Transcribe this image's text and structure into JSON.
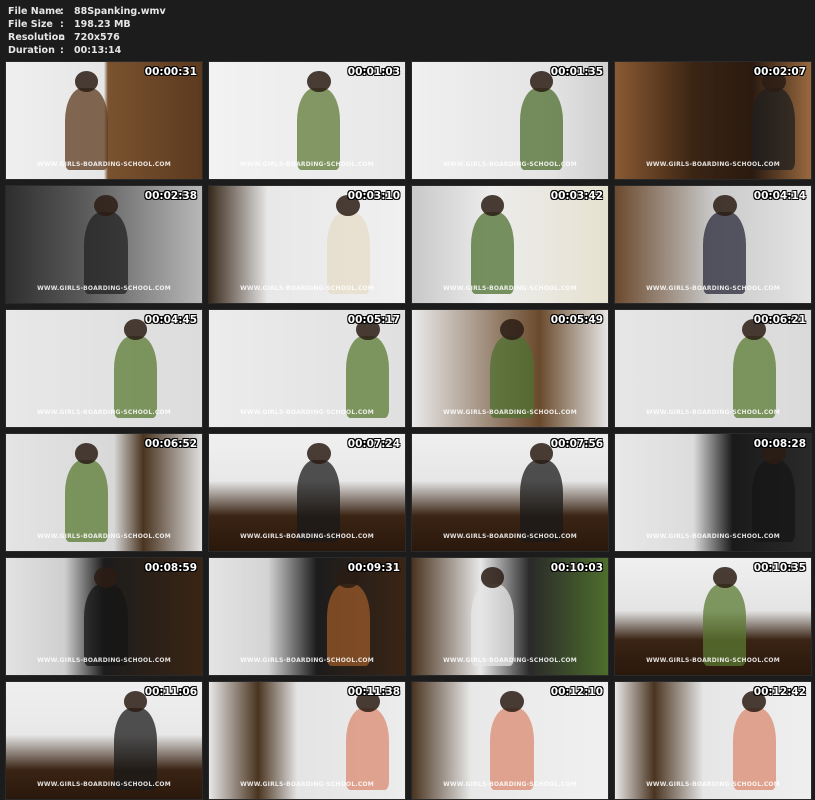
{
  "header": {
    "rows": [
      {
        "label": "File Name",
        "sep": ":",
        "value": "88Spanking.wmv"
      },
      {
        "label": "File Size",
        "sep": ":",
        "value": "198.23 MB"
      },
      {
        "label": "Resolution",
        "sep": ":",
        "value": "720x576"
      },
      {
        "label": "Duration",
        "sep": ":",
        "value": "00:13:14"
      }
    ]
  },
  "watermark": "WWW.GIRLS-BOARDING-SCHOOL.COM",
  "thumbnails": [
    {
      "timestamp": "00:00:31",
      "bg": "linear-gradient(90deg,#efefef 0%,#e6e6e6 50%,#7a5230 52%,#5c3a1e 100%)",
      "fg": "#5c3a1e"
    },
    {
      "timestamp": "00:01:03",
      "bg": "linear-gradient(90deg,#f2f2f2 0%,#e8e8e8 100%)",
      "fg": "#5f7a36"
    },
    {
      "timestamp": "00:01:35",
      "bg": "linear-gradient(90deg,#f0f0f0 0%,#e4e4e4 70%,#cfcfcf 100%)",
      "fg": "#4d6e2c"
    },
    {
      "timestamp": "00:02:07",
      "bg": "linear-gradient(90deg,#8a5a32 0%,#3b2414 40%,#2a1a10 70%,#9a6a40 100%)",
      "fg": "#1f1f1f"
    },
    {
      "timestamp": "00:02:38",
      "bg": "linear-gradient(90deg,#2e2e2e 0%,#5a5a5a 40%,#b8b8b8 100%)",
      "fg": "#222"
    },
    {
      "timestamp": "00:03:10",
      "bg": "linear-gradient(90deg,#3a2a1c 0%,#e8e8e8 30%,#f0f0f0 100%)",
      "fg": "#e5dcc8"
    },
    {
      "timestamp": "00:03:42",
      "bg": "linear-gradient(90deg,#c8c8c8 0%,#ececec 40%,#e6e2d0 100%)",
      "fg": "#4e7030"
    },
    {
      "timestamp": "00:04:14",
      "bg": "linear-gradient(90deg,#6b4a2e 0%,#c9c9c9 50%,#e4e4e4 100%)",
      "fg": "#2a2a3a"
    },
    {
      "timestamp": "00:04:45",
      "bg": "linear-gradient(90deg,#e8e8e8 0%,#dcdcdc 100%)",
      "fg": "#5a7a32"
    },
    {
      "timestamp": "00:05:17",
      "bg": "linear-gradient(90deg,#ececec 0%,#e0e0e0 100%)",
      "fg": "#5a7a32"
    },
    {
      "timestamp": "00:05:49",
      "bg": "linear-gradient(90deg,#eaeaea 0%,#6a4a2c 65%,#e6e6e6 100%)",
      "fg": "#4f7030"
    },
    {
      "timestamp": "00:06:21",
      "bg": "linear-gradient(90deg,#e6e6e6 0%,#dadada 100%)",
      "fg": "#5a7a32"
    },
    {
      "timestamp": "00:06:52",
      "bg": "linear-gradient(90deg,#e4e4e4 0%,#d8d8d8 55%,#4a3420 70%,#e0e0e0 100%)",
      "fg": "#5a7a32"
    },
    {
      "timestamp": "00:07:24",
      "bg": "linear-gradient(180deg,#f0f0f0 0%,#e8e8e8 40%,#3a2414 70%,#2a180c 100%)",
      "fg": "#1a1a1a"
    },
    {
      "timestamp": "00:07:56",
      "bg": "linear-gradient(180deg,#efefef 0%,#e6e6e6 40%,#3a2414 70%,#2a180c 100%)",
      "fg": "#1a1a1a"
    },
    {
      "timestamp": "00:08:28",
      "bg": "linear-gradient(90deg,#e8e8e8 0%,#dcdcdc 40%,#1a1a1a 60%,#2a2a2a 100%)",
      "fg": "#151515"
    },
    {
      "timestamp": "00:08:59",
      "bg": "linear-gradient(90deg,#e2e2e2 0%,#cfcfcf 30%,#1c1c1c 50%,#3a2414 100%)",
      "fg": "#151515"
    },
    {
      "timestamp": "00:09:31",
      "bg": "linear-gradient(90deg,#e4e4e4 0%,#d4d4d4 30%,#1c1c1c 55%,#3a2414 100%)",
      "fg": "#9a5a2a"
    },
    {
      "timestamp": "00:10:03",
      "bg": "linear-gradient(90deg,#4a3420 0%,#e8e8e8 35%,#2a2a2a 60%,#4d6e2c 100%)",
      "fg": "#e6e6e6"
    },
    {
      "timestamp": "00:10:35",
      "bg": "linear-gradient(180deg,#f0f0f0 0%,#e4e4e4 45%,#3a2414 70%,#2a180c 100%)",
      "fg": "#5a7a32"
    },
    {
      "timestamp": "00:11:06",
      "bg": "linear-gradient(180deg,#efefef 0%,#e8e8e8 45%,#3a2414 75%,#2a180c 100%)",
      "fg": "#1a1a1a"
    },
    {
      "timestamp": "00:11:38",
      "bg": "linear-gradient(90deg,#e8e8e8 0%,#4a3420 25%,#e4e4e4 45%,#ececec 100%)",
      "fg": "#d98a70"
    },
    {
      "timestamp": "00:12:10",
      "bg": "linear-gradient(90deg,#4a3420 0%,#e8e8e8 30%,#f0f0f0 100%)",
      "fg": "#d98a70"
    },
    {
      "timestamp": "00:12:42",
      "bg": "linear-gradient(90deg,#e8e8e8 0%,#4a3420 20%,#e6e6e6 45%,#efefef 100%)",
      "fg": "#d98a70"
    }
  ]
}
